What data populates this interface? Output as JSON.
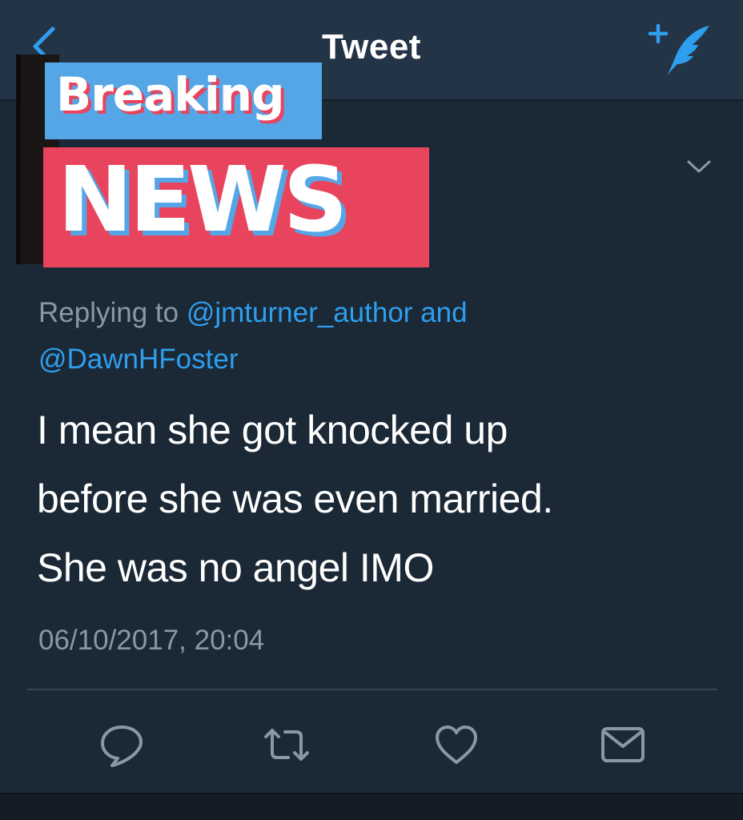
{
  "header": {
    "title": "Tweet",
    "back_icon": "chevron-left-icon",
    "compose_icon": "compose-tweet-icon"
  },
  "overlay": {
    "breaking": "Breaking",
    "news": "NEWS"
  },
  "tweet": {
    "replying_prefix": "Replying to",
    "reply_handle_1": "@jmturner_author",
    "reply_joiner": "and",
    "reply_handle_2": "@DawnHFoster",
    "text_line_1": "I mean she got knocked up",
    "text_line_2": "before she was even married.",
    "text_line_3": "She was no angel IMO",
    "timestamp": "06/10/2017, 20:04"
  },
  "actions": [
    "reply-icon",
    "retweet-icon",
    "like-icon",
    "direct-message-icon"
  ],
  "colors": {
    "background": "#1b2836",
    "header": "#243447",
    "accent_blue": "#2e9fee",
    "muted_text": "#8899a6",
    "news_red": "#e8445e",
    "breaking_blue": "#55a6e6"
  }
}
